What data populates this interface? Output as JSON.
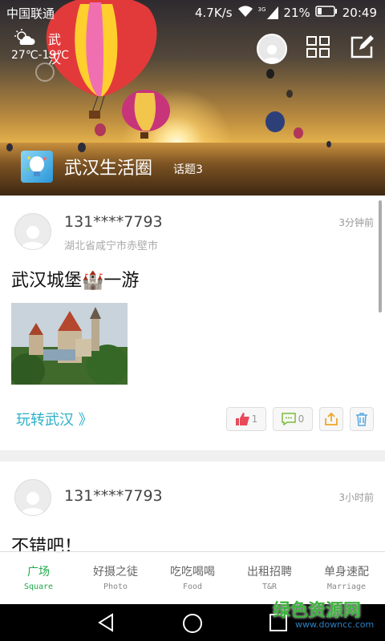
{
  "status": {
    "carrier": "中国联通",
    "speed": "4.7K/s",
    "network": "3G",
    "battery": "21%",
    "time": "20:49"
  },
  "weather": {
    "city": "武汉",
    "temperature": "27℃-19℃"
  },
  "group": {
    "name": "武汉生活圈",
    "topics": "话题3"
  },
  "posts": [
    {
      "user": "131****7793",
      "location": "湖北省咸宁市赤壁市",
      "time": "3分钟前",
      "title": "武汉城堡🏰一游",
      "circle": "玩转武汉 》",
      "likes": "1",
      "comments": "0"
    },
    {
      "user": "131****7793",
      "time": "3小时前",
      "title": "不错吧！"
    }
  ],
  "tabs": [
    {
      "cn": "广场",
      "en": "Square"
    },
    {
      "cn": "好摄之徒",
      "en": "Photo"
    },
    {
      "cn": "吃吃喝喝",
      "en": "Food"
    },
    {
      "cn": "出租招聘",
      "en": "T&R"
    },
    {
      "cn": "单身速配",
      "en": "Marriage"
    }
  ],
  "watermark": {
    "title": "绿色资源网",
    "url": "www.downcc.com"
  },
  "colors": {
    "accent": "#1faa4a",
    "link": "#2ab0c8"
  }
}
